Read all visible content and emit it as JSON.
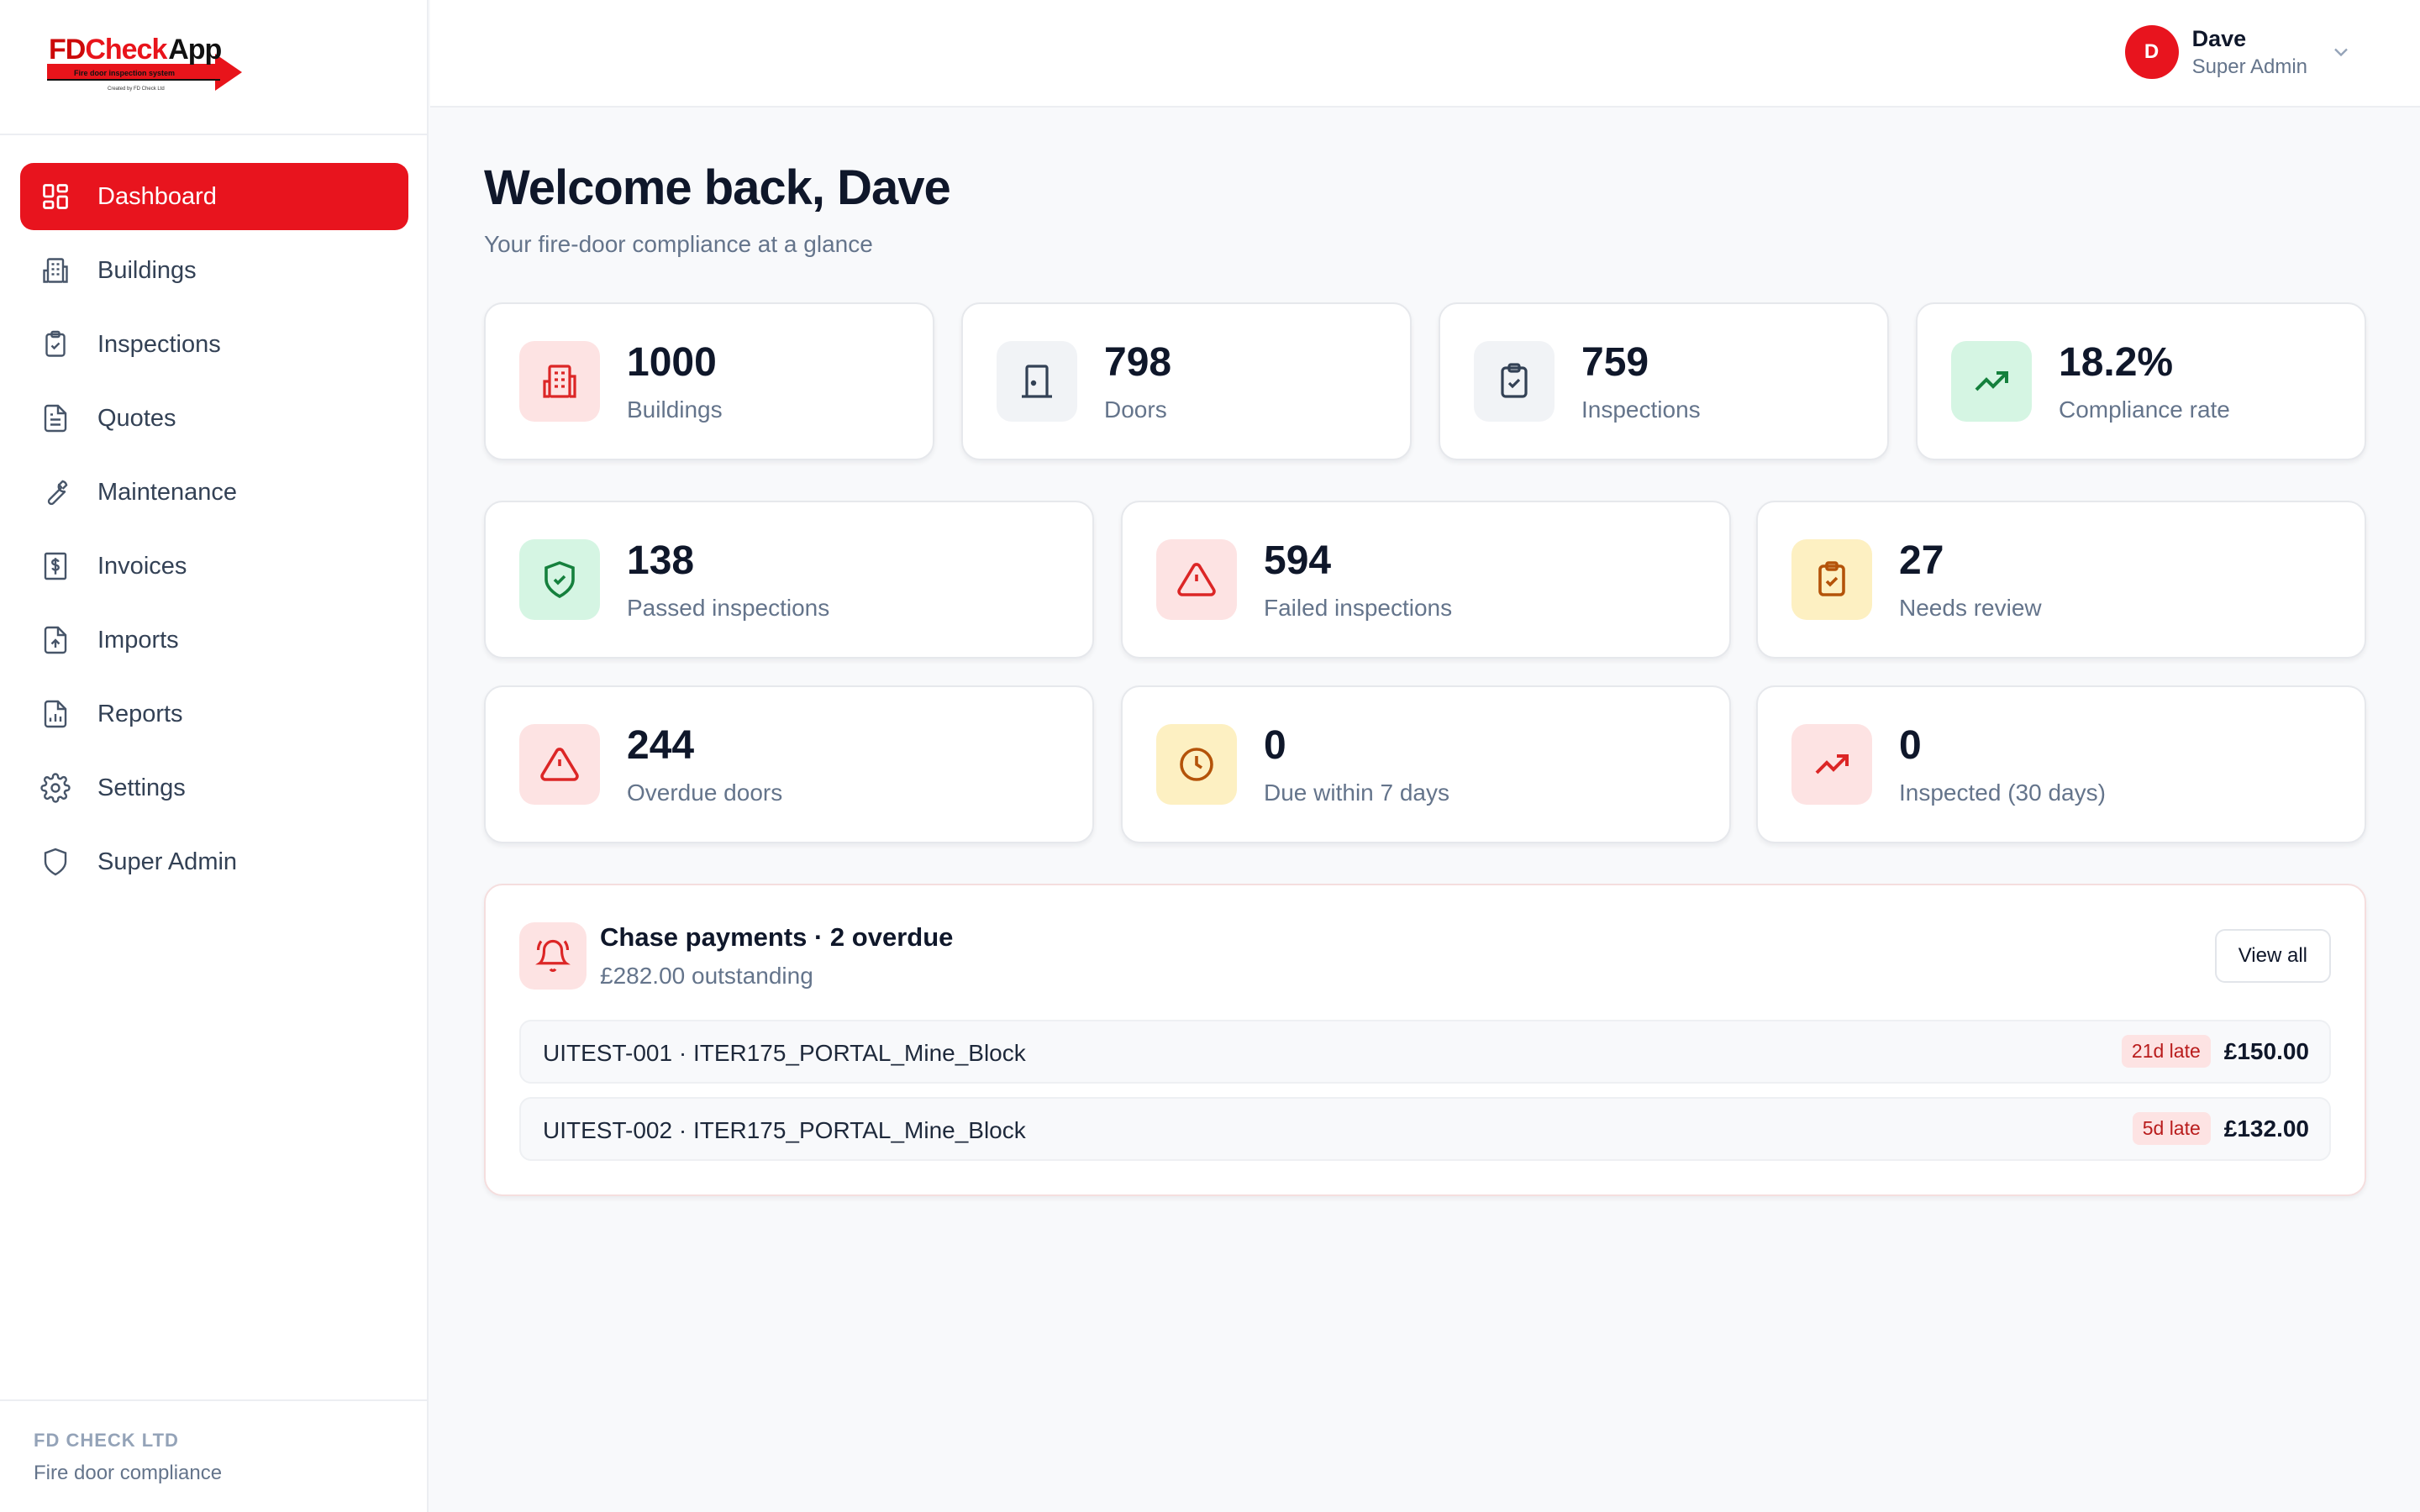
{
  "brand": {
    "logo_fd": "FD",
    "logo_check": "Check",
    "logo_app": "App",
    "logo_tagline": "Fire door inspection system",
    "logo_credit": "Created by FD Check Ltd"
  },
  "sidebar": {
    "items": [
      {
        "label": "Dashboard",
        "icon": "dashboard-icon",
        "active": true
      },
      {
        "label": "Buildings",
        "icon": "building-icon"
      },
      {
        "label": "Inspections",
        "icon": "clipboard-check-icon"
      },
      {
        "label": "Quotes",
        "icon": "file-text-icon"
      },
      {
        "label": "Maintenance",
        "icon": "wrench-icon"
      },
      {
        "label": "Invoices",
        "icon": "receipt-dollar-icon"
      },
      {
        "label": "Imports",
        "icon": "file-upload-icon"
      },
      {
        "label": "Reports",
        "icon": "file-chart-icon"
      },
      {
        "label": "Settings",
        "icon": "gear-icon"
      },
      {
        "label": "Super Admin",
        "icon": "shield-icon"
      }
    ],
    "footer": {
      "company": "FD CHECK LTD",
      "tagline": "Fire door compliance"
    }
  },
  "user": {
    "initial": "D",
    "name": "Dave",
    "role": "Super Admin"
  },
  "header": {
    "welcome": "Welcome back, Dave",
    "subtitle": "Your fire-door compliance at a glance"
  },
  "stats_top": [
    {
      "value": "1000",
      "label": "Buildings",
      "icon": "building-icon",
      "tone": "red"
    },
    {
      "value": "798",
      "label": "Doors",
      "icon": "door-icon",
      "tone": "gray"
    },
    {
      "value": "759",
      "label": "Inspections",
      "icon": "clipboard-check-icon",
      "tone": "gray"
    },
    {
      "value": "18.2%",
      "label": "Compliance rate",
      "icon": "trending-up-icon",
      "tone": "green"
    }
  ],
  "stats_mid": [
    {
      "value": "138",
      "label": "Passed inspections",
      "icon": "shield-check-icon",
      "tone": "green"
    },
    {
      "value": "594",
      "label": "Failed inspections",
      "icon": "warning-icon",
      "tone": "red"
    },
    {
      "value": "27",
      "label": "Needs review",
      "icon": "clipboard-check-icon",
      "tone": "yellow"
    }
  ],
  "stats_bottom": [
    {
      "value": "244",
      "label": "Overdue doors",
      "icon": "warning-icon",
      "tone": "red"
    },
    {
      "value": "0",
      "label": "Due within 7 days",
      "icon": "clock-icon",
      "tone": "yellow"
    },
    {
      "value": "0",
      "label": "Inspected (30 days)",
      "icon": "trending-up-icon",
      "tone": "red"
    }
  ],
  "payments": {
    "title": "Chase payments · 2 overdue",
    "subtitle": "£282.00 outstanding",
    "view_all": "View all",
    "rows": [
      {
        "ref": "UITEST-001 · ITER175_PORTAL_Mine_Block",
        "late": "21d late",
        "amount": "£150.00"
      },
      {
        "ref": "UITEST-002 · ITER175_PORTAL_Mine_Block",
        "late": "5d late",
        "amount": "£132.00"
      }
    ]
  },
  "colors": {
    "accent": "#e8141e",
    "green": "#16a34a",
    "red": "#dc2626",
    "amber": "#d97706",
    "slate": "#475569"
  }
}
